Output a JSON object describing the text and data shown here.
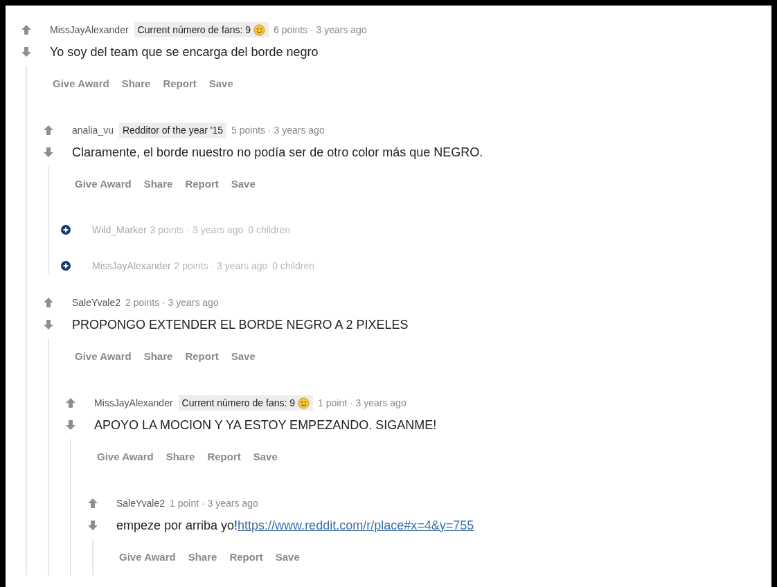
{
  "comments": [
    {
      "kind": "comment",
      "author": "MissJayAlexander",
      "flair": "Current número de fans: 9",
      "flair_icon": true,
      "meta": "6 points · 3 years ago",
      "body": "Yo soy del team que se encarga del borde negro",
      "actions": [
        "Give Award",
        "Share",
        "Report",
        "Save"
      ],
      "children": [
        {
          "kind": "comment",
          "author": "analia_vu",
          "flair": "Redditor of the year '15",
          "flair_icon": false,
          "meta": "5 points · 3 years ago",
          "body": "Claramente, el borde nuestro no podía ser de otro color más que NEGRO.",
          "actions": [
            "Give Award",
            "Share",
            "Report",
            "Save"
          ],
          "children": [
            {
              "kind": "collapsed",
              "author": "Wild_Marker",
              "meta": "3 points · 3 years ago",
              "count": "0 children"
            },
            {
              "kind": "collapsed",
              "author": "MissJayAlexander",
              "meta": "2 points · 3 years ago",
              "count": "0 children"
            }
          ]
        },
        {
          "kind": "comment",
          "author": "SaleYvale2",
          "meta": "2 points · 3 years ago",
          "body": "PROPONGO EXTENDER EL BORDE NEGRO A 2 PIXELES",
          "actions": [
            "Give Award",
            "Share",
            "Report",
            "Save"
          ],
          "children": [
            {
              "kind": "comment",
              "author": "MissJayAlexander",
              "flair": "Current número de fans: 9",
              "flair_icon": true,
              "meta": "1 point · 3 years ago",
              "body": "APOYO LA MOCION Y YA ESTOY EMPEZANDO. SIGANME!",
              "actions": [
                "Give Award",
                "Share",
                "Report",
                "Save"
              ],
              "children": [
                {
                  "kind": "comment",
                  "author": "SaleYvale2",
                  "meta": "1 point · 3 years ago",
                  "body": "empeze por arriba yo!",
                  "link": "https://www.reddit.com/r/place#x=4&y=755",
                  "actions": [
                    "Give Award",
                    "Share",
                    "Report",
                    "Save"
                  ]
                }
              ]
            }
          ]
        }
      ]
    }
  ]
}
